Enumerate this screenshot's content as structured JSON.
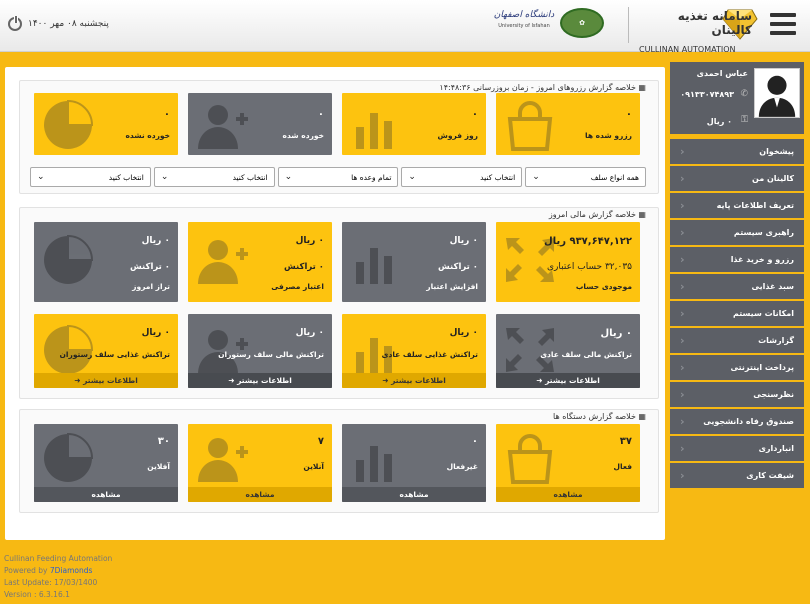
{
  "header": {
    "brand_fa": "سامانه تغذیه کالینان",
    "brand_en": "CULLINAN AUTOMATION",
    "university_fa": "دانشگاه اصفهان",
    "university_en": "University of Isfahan",
    "date": "پنجشنبه ۰۸ مهر ۱۴۰۰"
  },
  "reservations": {
    "title": "خلاصه گزارش رزروهای امروز - زمان بروزرسانی ۱۴:۴۸:۳۶",
    "tiles": [
      {
        "value": "۰",
        "label": "رزرو شده ها"
      },
      {
        "value": "۰",
        "label": "روز فروش"
      },
      {
        "value": "۰",
        "label": "خورده شده"
      },
      {
        "value": "۰",
        "label": "خورده نشده"
      }
    ],
    "selects": [
      "همه انواع سلف",
      "انتخاب کنید",
      "تمام وعده ها",
      "انتخاب کنید",
      "انتخاب کنید"
    ]
  },
  "financial": {
    "title": "خلاصه گزارش مالی امروز",
    "row1": [
      {
        "value": "۹۳۷,۶۴۷,۱۲۲ ریال",
        "value2": "۳۲,۰۳۵ حساب اعتباری",
        "label": "موجودی حساب"
      },
      {
        "value": "۰ ریال",
        "value2": "۰ تراکنش",
        "label": "افزایش اعتبار"
      },
      {
        "value": "۰ ریال",
        "value2": "۰ تراکنش",
        "label": "اعتبار مصرفی"
      },
      {
        "value": "۰ ریال",
        "value2": "۰ تراکنش",
        "label": "تراز امروز"
      }
    ],
    "row2": [
      {
        "value": "۰ ریال",
        "label": "تراکنش مالی سلف عادی",
        "footer": "اطلاعات بیشتر ➜"
      },
      {
        "value": "۰ ریال",
        "label": "تراکنش غذایی سلف عادی",
        "footer": "اطلاعات بیشتر ➜"
      },
      {
        "value": "۰ ریال",
        "label": "تراکنش مالی سلف رستوران",
        "footer": "اطلاعات بیشتر ➜"
      },
      {
        "value": "۰ ریال",
        "label": "تراکنش غذایی سلف رستوران",
        "footer": "اطلاعات بیشتر ➜"
      }
    ]
  },
  "devices": {
    "title": "خلاصه گزارش دستگاه ها",
    "tiles": [
      {
        "value": "۳۷",
        "label": "فعال",
        "footer": "مشاهده"
      },
      {
        "value": "۰",
        "label": "غیرفعال",
        "footer": "مشاهده"
      },
      {
        "value": "۷",
        "label": "آنلاین",
        "footer": "مشاهده"
      },
      {
        "value": "۳۰",
        "label": "آفلاین",
        "footer": "مشاهده"
      }
    ]
  },
  "user": {
    "name": "عباس احمدی",
    "phone": "۰۹۱۳۳۰۷۴۸۹۳",
    "balance": "۰ ریال"
  },
  "menu": [
    "پیشخوان",
    "کالینان من",
    "تعریف اطلاعات پایه",
    "راهبری سیستم",
    "رزرو و خرید غذا",
    "سبد غذایی",
    "امکانات سیستم",
    "گزارشات",
    "پرداخت اینترنتی",
    "نظرسنجی",
    "صندوق رفاه دانشجویی",
    "انبارداری",
    "شیفت کاری"
  ],
  "footer": {
    "line1": "Cullinan Feeding Automation",
    "powered": "Powered by",
    "link": "7Diamonds",
    "update": "Last Update: 17/03/1400",
    "version": "Version : 6.3.16.1"
  }
}
